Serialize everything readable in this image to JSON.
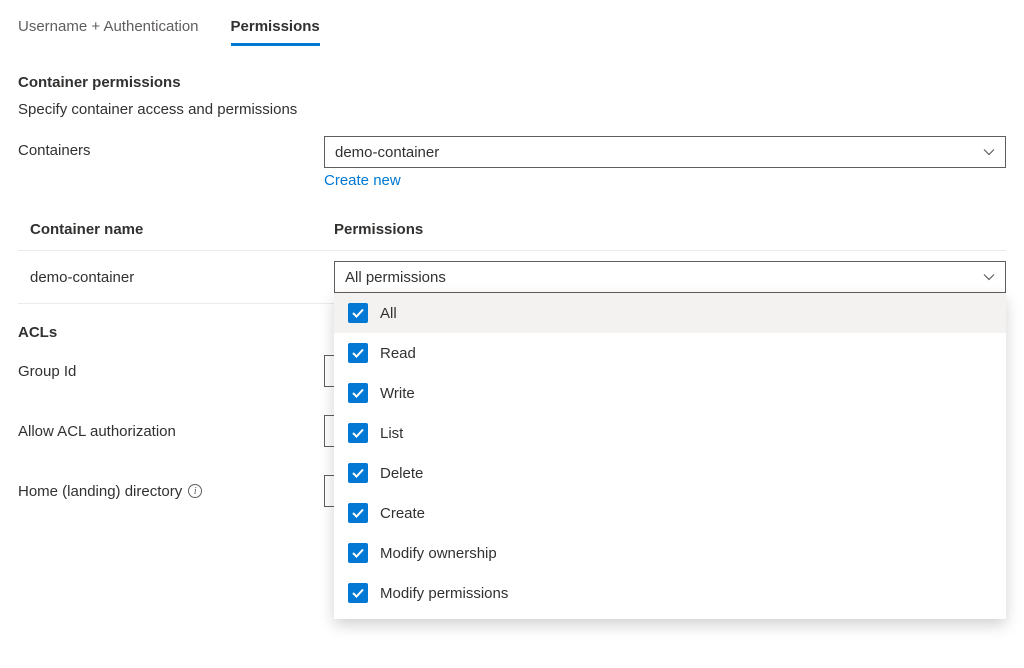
{
  "tabs": {
    "auth": "Username + Authentication",
    "permissions": "Permissions"
  },
  "container_permissions": {
    "title": "Container permissions",
    "subtitle": "Specify container access and permissions",
    "containers_label": "Containers",
    "selected_container": "demo-container",
    "create_new": "Create new"
  },
  "table": {
    "col_name": "Container name",
    "col_perm": "Permissions",
    "row": {
      "name": "demo-container",
      "perm_value": "All permissions"
    }
  },
  "dropdown": {
    "items": [
      {
        "label": "All",
        "checked": true
      },
      {
        "label": "Read",
        "checked": true
      },
      {
        "label": "Write",
        "checked": true
      },
      {
        "label": "List",
        "checked": true
      },
      {
        "label": "Delete",
        "checked": true
      },
      {
        "label": "Create",
        "checked": true
      },
      {
        "label": "Modify ownership",
        "checked": true
      },
      {
        "label": "Modify permissions",
        "checked": true
      }
    ]
  },
  "acls": {
    "title": "ACLs",
    "group_id": "Group Id",
    "allow_acl": "Allow ACL authorization",
    "home_dir": "Home (landing) directory"
  }
}
